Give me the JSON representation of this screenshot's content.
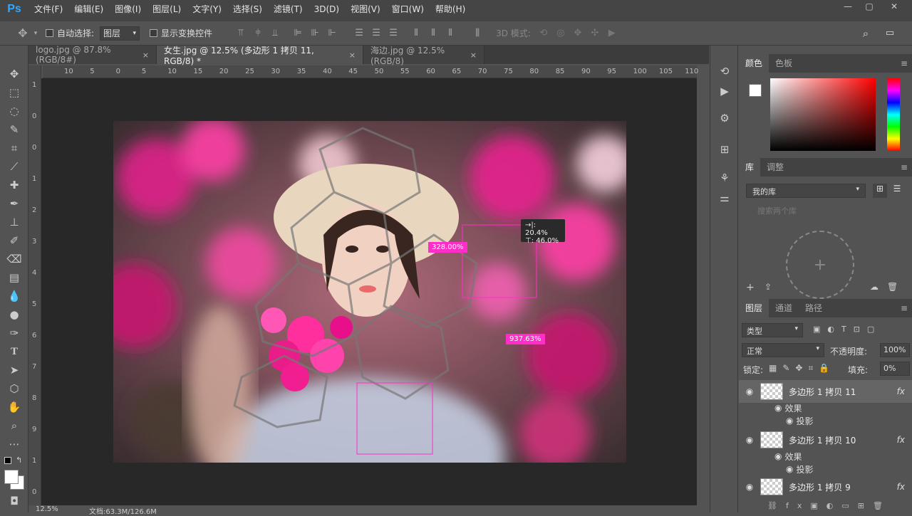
{
  "app": {
    "logo": "Ps"
  },
  "menu": [
    "文件(F)",
    "编辑(E)",
    "图像(I)",
    "图层(L)",
    "文字(Y)",
    "选择(S)",
    "滤镜(T)",
    "3D(D)",
    "视图(V)",
    "窗口(W)",
    "帮助(H)"
  ],
  "options": {
    "auto_select": "自动选择:",
    "auto_select_target": "图层",
    "show_transform": "显示变换控件",
    "mode_3d": "3D 模式:"
  },
  "tabs": [
    {
      "label": "logo.jpg @ 87.8%(RGB/8#)",
      "close": "×"
    },
    {
      "label": "女生.jpg @ 12.5% (多边形 1 拷贝 11, RGB/8) *",
      "close": "×"
    },
    {
      "label": "海边.jpg @ 12.5%(RGB/8)",
      "close": "×"
    }
  ],
  "ruler": {
    "top": [
      "10",
      "5",
      "0",
      "5",
      "10",
      "15",
      "20",
      "25",
      "30",
      "35",
      "40",
      "45",
      "50",
      "55",
      "60",
      "65",
      "70",
      "75",
      "80",
      "85",
      "90",
      "95",
      "100",
      "105",
      "110"
    ],
    "left": [
      "1",
      "0",
      "0",
      "1",
      "2",
      "3",
      "4",
      "5",
      "6",
      "7",
      "8",
      "9",
      "1",
      "0"
    ]
  },
  "canvas": {
    "label_1": "328.00%",
    "label_2": "937.63%",
    "tooltip_w": "→|: 20.4%",
    "tooltip_h": "⊤: 46.0%"
  },
  "color_panel": {
    "tab_color": "颜色",
    "tab_swatch": "色板",
    "accent": "#ff2ec8"
  },
  "library_panel": {
    "tab_library": "库",
    "tab_adjust": "调整",
    "my_library": "我的库",
    "search_placeholder": "搜索两个库"
  },
  "layers_panel": {
    "tab_layers": "图层",
    "tab_channels": "通道",
    "tab_paths": "路径",
    "filter": "类型",
    "blend": "正常",
    "opacity_label": "不透明度:",
    "opacity": "100%",
    "lock_label": "锁定:",
    "fill_label": "填充:",
    "fill": "0%",
    "layers": [
      {
        "name": "多边形 1 拷贝 11",
        "effects": "效果",
        "shadow": "投影"
      },
      {
        "name": "多边形 1 拷贝 10",
        "effects": "效果",
        "shadow": "投影"
      },
      {
        "name": "多边形 1 拷贝 9"
      }
    ]
  },
  "status": {
    "zoom": "12.5%",
    "doc": "文档:63.3M/126.6M"
  }
}
